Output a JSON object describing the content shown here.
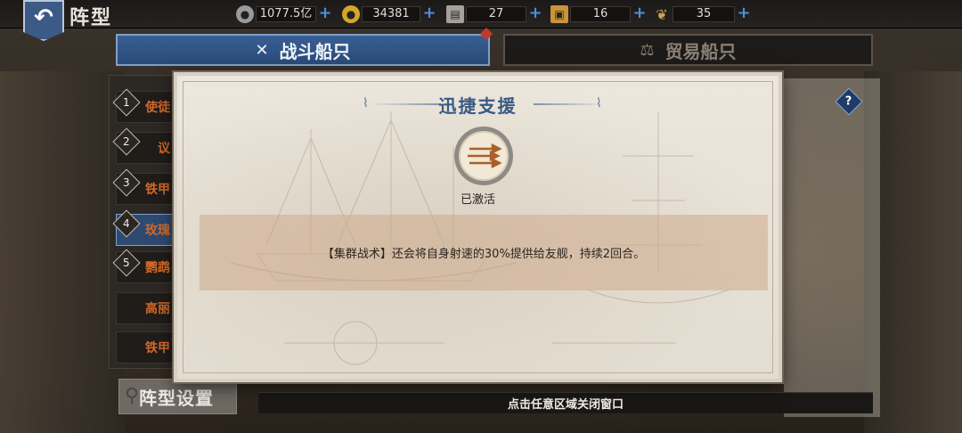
{
  "header": {
    "title": "阵型",
    "back_icon": "back-arrow-icon"
  },
  "resources": [
    {
      "name": "silver",
      "icon": "silver-coin-icon",
      "value": "1077.5亿",
      "color": "#9a9a9a"
    },
    {
      "name": "gold",
      "icon": "gold-coin-icon",
      "value": "34381",
      "color": "#d4a628"
    },
    {
      "name": "scroll",
      "icon": "scroll-icon",
      "value": "27",
      "color": "#a5a09a"
    },
    {
      "name": "medal",
      "icon": "medal-icon",
      "value": "16",
      "color": "#c8933a"
    },
    {
      "name": "laurel",
      "icon": "laurel-icon",
      "value": "35",
      "color": "#c9a55a"
    }
  ],
  "tabs": [
    {
      "label": "战斗船只",
      "icon": "crossed-swords-icon",
      "active": true
    },
    {
      "label": "贸易船只",
      "icon": "scales-icon",
      "active": false
    }
  ],
  "list": [
    {
      "num": "1",
      "label": "使徒"
    },
    {
      "num": "2",
      "label": "议"
    },
    {
      "num": "3",
      "label": "铁甲"
    },
    {
      "num": "4",
      "label": "玫瑰"
    },
    {
      "num": "5",
      "label": "鹦鹉"
    },
    {
      "num": "",
      "label": "高丽"
    },
    {
      "num": "",
      "label": "铁甲"
    }
  ],
  "formation_button": "阵型设置",
  "close_hint": "点击任意区域关闭窗口",
  "modal": {
    "title": "迅捷支援",
    "emblem_icon": "triple-arrows-icon",
    "status": "已激活",
    "description": "【集群战术】还会将自身射速的30%提供给友舰，持续2回合。"
  },
  "colors": {
    "accent_blue": "#3a5a86",
    "highlight_orange": "#d46a2a"
  }
}
